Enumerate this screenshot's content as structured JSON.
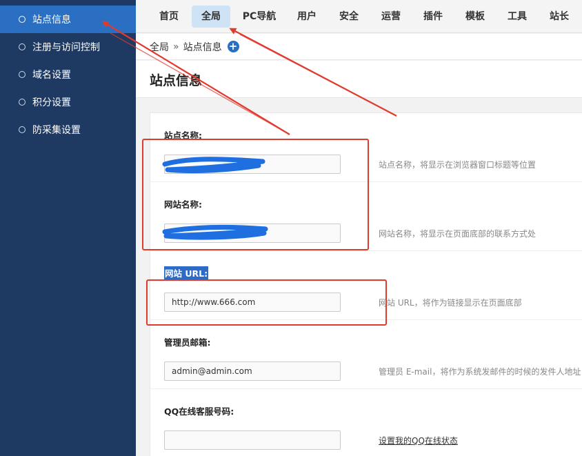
{
  "sidebar": {
    "items": [
      {
        "label": "站点信息",
        "active": true
      },
      {
        "label": "注册与访问控制",
        "active": false
      },
      {
        "label": "域名设置",
        "active": false
      },
      {
        "label": "积分设置",
        "active": false
      },
      {
        "label": "防采集设置",
        "active": false
      }
    ]
  },
  "topnav": {
    "tabs": [
      {
        "label": "首页",
        "active": false
      },
      {
        "label": "全局",
        "active": true
      },
      {
        "label": "PC导航",
        "active": false
      },
      {
        "label": "用户",
        "active": false
      },
      {
        "label": "安全",
        "active": false
      },
      {
        "label": "运营",
        "active": false
      },
      {
        "label": "插件",
        "active": false
      },
      {
        "label": "模板",
        "active": false
      },
      {
        "label": "工具",
        "active": false
      },
      {
        "label": "站长",
        "active": false
      }
    ]
  },
  "breadcrumb": {
    "root": "全局",
    "separator": "»",
    "current": "站点信息",
    "add_icon": "plus-circle-icon"
  },
  "page": {
    "title": "站点信息"
  },
  "form": {
    "site_name": {
      "label": "站点名称:",
      "value": "",
      "hint": "站点名称，将显示在浏览器窗口标题等位置"
    },
    "web_name": {
      "label": "网站名称:",
      "value": "",
      "hint": "网站名称，将显示在页面底部的联系方式处"
    },
    "site_url": {
      "label": "网站 URL:",
      "value": "http://www.666.com",
      "hint": "网站 URL，将作为链接显示在页面底部"
    },
    "admin_email": {
      "label": "管理员邮箱:",
      "value": "admin@admin.com",
      "hint": "管理员 E-mail，将作为系统发邮件的时候的发件人地址"
    },
    "qq": {
      "label": "QQ在线客服号码:",
      "value": "",
      "hint_link": "设置我的QQ在线状态"
    }
  },
  "colors": {
    "sidebar_bg": "#1e3a63",
    "sidebar_active": "#2b6fc2",
    "tab_active": "#cfe3f7",
    "annotation": "#e03a2f",
    "redaction": "#1f6fe0"
  }
}
